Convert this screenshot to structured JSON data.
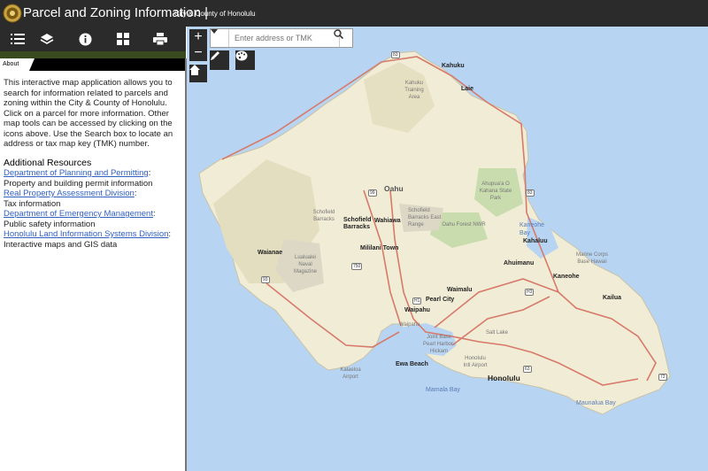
{
  "header": {
    "title": "Parcel and Zoning Information |",
    "subtitle": "City & County of Honolulu"
  },
  "toolbar": {
    "icons": [
      "list-icon",
      "layers-icon",
      "info-icon",
      "basemap-gallery-icon",
      "print-icon"
    ]
  },
  "tabs": {
    "about": "About"
  },
  "about": {
    "intro": "This interactive map application allows you to search for information related to parcels and zoning within the City & County of Honolulu. Click on a parcel for more information. Other map tools can be accessed by clicking on the icons above. Use the Search box to locate an address or tax map key (TMK) number.",
    "resources_heading": "Additional Resources",
    "resources": [
      {
        "link": "Department of Planning and Permitting",
        "suffix": ":",
        "desc": "Property and building permit information"
      },
      {
        "link": "Real Property Assessment Division",
        "suffix": ":",
        "desc": "Tax information"
      },
      {
        "link": "Department of Emergency Management",
        "suffix": ":",
        "desc": "Public safety information"
      },
      {
        "link": "Honolulu Land Information Systems Division",
        "suffix": ":",
        "desc": "Interactive maps and GIS data"
      }
    ]
  },
  "map": {
    "zoom_in": "+",
    "zoom_out": "−",
    "search_placeholder": "Enter address or TMK",
    "colors": {
      "water": "#b7d4f2",
      "land": "#f0ecd6",
      "highway": "#d77a6a",
      "park": "#c9dcae"
    },
    "labels": {
      "kahuku": "Kahuku",
      "laie": "Laie",
      "kahuku_area": "Kahuku Training Area",
      "oahu": "Oahu",
      "ahupuaa": "Ahupua'a O Kahana State Park",
      "schofield_barracks_area": "Schofield Barracks",
      "schofield": "Schofield Barracks",
      "wahiawa": "Wahiawa",
      "schofield_east": "Schofield Barracks East Range",
      "oahu_forest": "Oahu Forest NWR",
      "kaneohe_bay": "Kaneohe Bay",
      "kahaluu": "Kahaluu",
      "mililani": "Mililani Town",
      "waianae": "Waianae",
      "lualualei": "Lualualei Naval Magazine",
      "ahuimanu": "Ahuimanu",
      "marine_corps": "Marine Corps Base Hawaii",
      "kaneohe": "Kaneohe",
      "waimalu": "Waimalu",
      "kailua": "Kailua",
      "pearl_city": "Pearl City",
      "waipahu": "Waipahu",
      "waipahu_area": "Waipahu",
      "joint_base": "Joint Base Pearl Harbor-Hickam",
      "salt_lake": "Salt Lake",
      "honolulu_intl": "Honolulu Intl Airport",
      "ewa_beach": "Ewa Beach",
      "kalaeloa": "Kalaeloa Airport",
      "honolulu": "Honolulu",
      "mamala_bay": "Mamala Bay",
      "maunalua_bay": "Maunalua Bay",
      "rt_83a": "83",
      "rt_83b": "83",
      "rt_99": "99",
      "rt_93": "93",
      "rt_750": "750",
      "rt_h1": "H1",
      "rt_h3": "H3",
      "rt_72": "72",
      "rt_63": "63"
    }
  }
}
